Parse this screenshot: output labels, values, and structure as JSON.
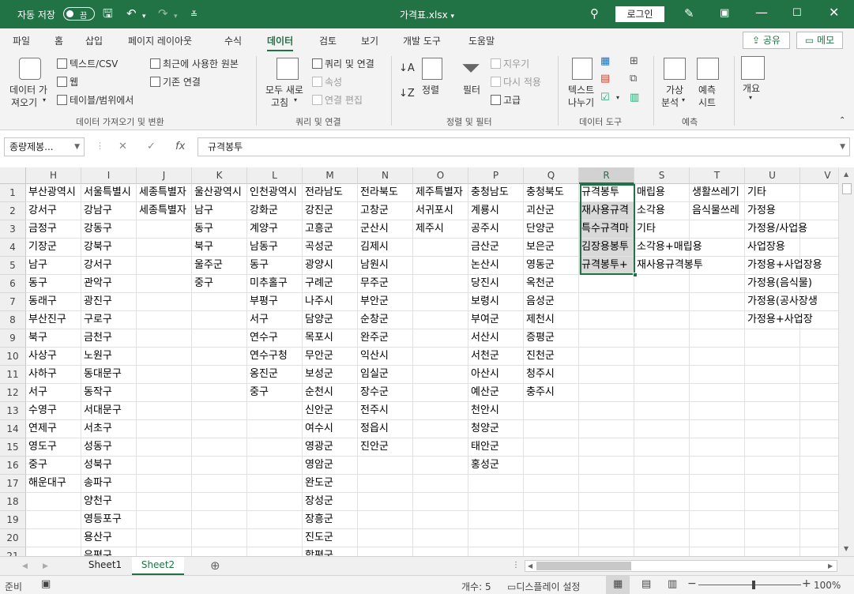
{
  "titlebar": {
    "autosave_label": "자동 저장",
    "autosave_state": "끔",
    "filename": "가격표.xlsx",
    "login_label": "로그인"
  },
  "menu": {
    "tabs": [
      "파일",
      "홈",
      "삽입",
      "페이지 레이아웃",
      "수식",
      "데이터",
      "검토",
      "보기",
      "개발 도구",
      "도움말"
    ],
    "active_tab": "데이터",
    "share_label": "공유",
    "memo_label": "메모"
  },
  "ribbon": {
    "get_data": {
      "line1": "데이터 가",
      "line2": "져오기"
    },
    "from_text_csv": "텍스트/CSV",
    "from_web": "웹",
    "from_table_range": "테이블/범위에서",
    "recent_sources": "최근에 사용한 원본",
    "existing_connections": "기존 연결",
    "group_get_transform": "데이터 가져오기 및 변환",
    "refresh_all": {
      "line1": "모두 새로",
      "line2": "고침"
    },
    "queries_connections": "쿼리 및 연결",
    "properties": "속성",
    "edit_links": "연결 편집",
    "group_queries": "쿼리 및 연결",
    "sort_label": "정렬",
    "filter_label": "필터",
    "clear_label": "지우기",
    "reapply_label": "다시 적용",
    "advanced_label": "고급",
    "group_sort_filter": "정렬 및 필터",
    "text_to_columns": {
      "line1": "텍스트",
      "line2": "나누기"
    },
    "group_data_tools": "데이터 도구",
    "what_if": {
      "line1": "가상",
      "line2": "분석"
    },
    "forecast_sheet": {
      "line1": "예측",
      "line2": "시트"
    },
    "group_forecast": "예측",
    "outline": "개요"
  },
  "formula_bar": {
    "name_box": "종량제봉...",
    "fx": "fx",
    "content": "규격봉투"
  },
  "grid": {
    "columns": [
      "H",
      "I",
      "J",
      "K",
      "L",
      "M",
      "N",
      "O",
      "P",
      "Q",
      "R",
      "S",
      "T",
      "U",
      "V"
    ],
    "selected_column": "R",
    "rows": [
      [
        "부산광역시",
        "서울특별시",
        "세종특별자",
        "울산광역시",
        "인천광역시",
        "전라남도",
        "전라북도",
        "제주특별자",
        "충청남도",
        "충청북도",
        "규격봉투",
        "매립용",
        "생활쓰레기",
        "기타",
        ""
      ],
      [
        "강서구",
        "강남구",
        "세종특별자",
        "남구",
        "강화군",
        "강진군",
        "고창군",
        "서귀포시",
        "계룡시",
        "괴산군",
        "재사용규격",
        "소각용",
        "음식물쓰레",
        "가정용",
        ""
      ],
      [
        "금정구",
        "강동구",
        "",
        "동구",
        "계양구",
        "고흥군",
        "군산시",
        "제주시",
        "공주시",
        "단양군",
        "특수규격마",
        "기타",
        "",
        "가정용/사업용",
        ""
      ],
      [
        "기장군",
        "강북구",
        "",
        "북구",
        "남동구",
        "곡성군",
        "김제시",
        "",
        "금산군",
        "보은군",
        "김장용봉투",
        "소각용+매립용",
        "",
        "사업장용",
        ""
      ],
      [
        "남구",
        "강서구",
        "",
        "울주군",
        "동구",
        "광양시",
        "남원시",
        "",
        "논산시",
        "영동군",
        "규격봉투+",
        "재사용규격봉투",
        "",
        "가정용+사업장용",
        ""
      ],
      [
        "동구",
        "관악구",
        "",
        "중구",
        "미추홀구",
        "구례군",
        "무주군",
        "",
        "당진시",
        "옥천군",
        "",
        "",
        "",
        "가정용(음식물)",
        ""
      ],
      [
        "동래구",
        "광진구",
        "",
        "",
        "부평구",
        "나주시",
        "부안군",
        "",
        "보령시",
        "음성군",
        "",
        "",
        "",
        "가정용(공사장생",
        ""
      ],
      [
        "부산진구",
        "구로구",
        "",
        "",
        "서구",
        "담양군",
        "순창군",
        "",
        "부여군",
        "제천시",
        "",
        "",
        "",
        "가정용+사업장",
        ""
      ],
      [
        "북구",
        "금천구",
        "",
        "",
        "연수구",
        "목포시",
        "완주군",
        "",
        "서산시",
        "증평군",
        "",
        "",
        "",
        "",
        ""
      ],
      [
        "사상구",
        "노원구",
        "",
        "",
        "연수구청",
        "무안군",
        "익산시",
        "",
        "서천군",
        "진천군",
        "",
        "",
        "",
        "",
        ""
      ],
      [
        "사하구",
        "동대문구",
        "",
        "",
        "옹진군",
        "보성군",
        "임실군",
        "",
        "아산시",
        "청주시",
        "",
        "",
        "",
        "",
        ""
      ],
      [
        "서구",
        "동작구",
        "",
        "",
        "중구",
        "순천시",
        "장수군",
        "",
        "예산군",
        "충주시",
        "",
        "",
        "",
        "",
        ""
      ],
      [
        "수영구",
        "서대문구",
        "",
        "",
        "",
        "신안군",
        "전주시",
        "",
        "천안시",
        "",
        "",
        "",
        "",
        "",
        ""
      ],
      [
        "연제구",
        "서초구",
        "",
        "",
        "",
        "여수시",
        "정읍시",
        "",
        "청양군",
        "",
        "",
        "",
        "",
        "",
        ""
      ],
      [
        "영도구",
        "성동구",
        "",
        "",
        "",
        "영광군",
        "진안군",
        "",
        "태안군",
        "",
        "",
        "",
        "",
        "",
        ""
      ],
      [
        "중구",
        "성북구",
        "",
        "",
        "",
        "영암군",
        "",
        "",
        "홍성군",
        "",
        "",
        "",
        "",
        "",
        ""
      ],
      [
        "해운대구",
        "송파구",
        "",
        "",
        "",
        "완도군",
        "",
        "",
        "",
        "",
        "",
        "",
        "",
        "",
        ""
      ],
      [
        "",
        "양천구",
        "",
        "",
        "",
        "장성군",
        "",
        "",
        "",
        "",
        "",
        "",
        "",
        "",
        ""
      ],
      [
        "",
        "영등포구",
        "",
        "",
        "",
        "장흥군",
        "",
        "",
        "",
        "",
        "",
        "",
        "",
        "",
        ""
      ],
      [
        "",
        "용산구",
        "",
        "",
        "",
        "진도군",
        "",
        "",
        "",
        "",
        "",
        "",
        "",
        "",
        ""
      ],
      [
        "",
        "은평구",
        "",
        "",
        "",
        "함평군",
        "",
        "",
        "",
        "",
        "",
        "",
        "",
        "",
        ""
      ]
    ]
  },
  "sheets": {
    "tabs": [
      "Sheet1",
      "Sheet2"
    ],
    "active": "Sheet2"
  },
  "status": {
    "ready": "준비",
    "count": "개수: 5",
    "display_settings": "디스플레이 설정",
    "zoom": "100%"
  },
  "colors": {
    "accent": "#217346",
    "selection_fill": "#d9d9d9"
  }
}
